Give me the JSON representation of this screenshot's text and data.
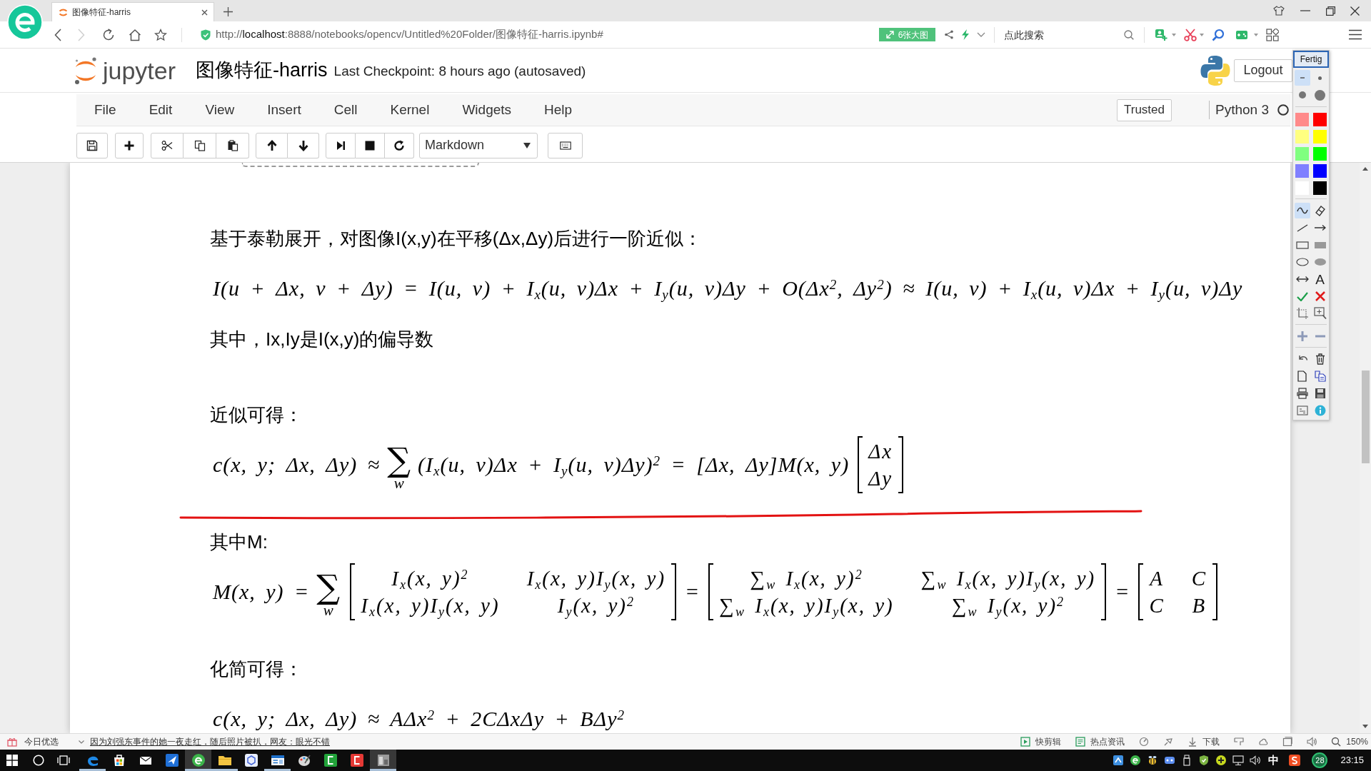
{
  "browser": {
    "tab": {
      "title": "图像特征-harris"
    },
    "forward": {
      "disabled": true
    },
    "address": {
      "url": "http://**localhost**:8888/notebooks/opencv/Untitled%20Folder/图像特征-harris.ipynb#"
    },
    "images_button": "6张大图",
    "search": {
      "placeholder": "点此搜索"
    }
  },
  "notebook": {
    "logo_text": "jupyter",
    "title": "图像特征-harris",
    "checkpoint": "Last Checkpoint: 8 hours ago (autosaved)",
    "logout": "Logout",
    "menu": [
      "File",
      "Edit",
      "View",
      "Insert",
      "Cell",
      "Kernel",
      "Widgets",
      "Help"
    ],
    "trusted": "Trusted",
    "kernel": "Python 3",
    "cell_type": "Markdown",
    "cells": [
      {
        "blocks": [
          {
            "kind": "text",
            "text": "基于泰勒展开，对图像I(x,y)在平移(Δx,Δy)后进行一阶近似："
          },
          {
            "kind": "formula",
            "parts": [
              {
                "kind": "expr",
                "text": "I(u + Δx, v + Δy) = I(u, v) + I$_{x}$(u, v)Δx + I$_{y}$(u, v)Δy + O(Δx$^{2}$, Δy$^{2}$) ≈ I(u, v) + I$_{x}$(u, v)Δx + I$_{y}$(u, v)Δy"
              }
            ]
          },
          {
            "kind": "text",
            "text": "其中，Ix,Iy是I(x,y)的偏导数"
          }
        ]
      },
      {
        "blocks": [
          {
            "kind": "text",
            "text": "近似可得："
          },
          {
            "kind": "formula",
            "parts": [
              {
                "kind": "expr",
                "text": "c(x, y; Δx, Δy) ≈"
              },
              {
                "kind": "sum",
                "symbol": "∑",
                "index": "w"
              },
              {
                "kind": "expr",
                "text": "(I$_{x}$(u, v)Δx + I$_{y}$(u, v)Δy)$^{2}$ = [Δx, Δy]M(x, y)"
              },
              {
                "kind": "matrix",
                "rows": [
                  [
                    "Δx"
                  ],
                  [
                    "Δy"
                  ]
                ]
              }
            ]
          }
        ]
      },
      {
        "blocks": [
          {
            "kind": "text",
            "text": "其中M:"
          },
          {
            "kind": "formula",
            "parts": [
              {
                "kind": "expr",
                "text": "M(x, y) ="
              },
              {
                "kind": "sum",
                "symbol": "∑",
                "index": "w"
              },
              {
                "kind": "matrix",
                "rows": [
                  [
                    "I$_{x}$(x, y)$^{2}$",
                    "I$_{x}$(x, y)I$_{y}$(x, y)"
                  ],
                  [
                    "I$_{x}$(x, y)I$_{y}$(x, y)",
                    "I$_{y}$(x, y)$^{2}$"
                  ]
                ]
              },
              {
                "kind": "expr",
                "text": "="
              },
              {
                "kind": "matrix",
                "rows": [
                  [
                    "∑$_{w}$ I$_{x}$(x, y)$^{2}$",
                    "∑$_{w}$ I$_{x}$(x, y)I$_{y}$(x, y)"
                  ],
                  [
                    "∑$_{w}$ I$_{x}$(x, y)I$_{y}$(x, y)",
                    "∑$_{w}$ I$_{y}$(x, y)$^{2}$"
                  ]
                ]
              },
              {
                "kind": "expr",
                "text": "="
              },
              {
                "kind": "matrix",
                "rows": [
                  [
                    "A",
                    "C"
                  ],
                  [
                    "C",
                    "B"
                  ]
                ]
              }
            ]
          }
        ]
      },
      {
        "blocks": [
          {
            "kind": "text",
            "text": "化简可得："
          },
          {
            "kind": "formula",
            "parts": [
              {
                "kind": "expr",
                "text": "c(x, y; Δx, Δy) ≈ AΔx$^{2}$ + 2CΔxΔy + BΔy$^{2}$"
              }
            ]
          }
        ]
      }
    ]
  },
  "annotation_palette": {
    "done_button": "Fertig",
    "sizes": [
      {
        "kind": "thin",
        "selected": true
      },
      {
        "kind": "small",
        "selected": false
      },
      {
        "kind": "medium",
        "selected": false
      },
      {
        "kind": "large",
        "selected": false
      }
    ],
    "colors": [
      {
        "color": "#ff8a8a"
      },
      {
        "color": "#ff0000"
      },
      {
        "color": "#ffff80"
      },
      {
        "color": "#ffff00"
      },
      {
        "color": "#80ff80"
      },
      {
        "color": "#00ff00"
      },
      {
        "color": "#8080ff"
      },
      {
        "color": "#0000ff"
      },
      {
        "color": "#ffffff"
      },
      {
        "color": "#000000"
      }
    ],
    "tools": [
      {
        "kind": "pen",
        "selected": true
      },
      {
        "kind": "eraser",
        "selected": false
      },
      {
        "kind": "line",
        "selected": false
      },
      {
        "kind": "arrow",
        "selected": false
      },
      {
        "kind": "rectangle",
        "selected": false
      },
      {
        "kind": "filled_rectangle",
        "selected": false
      },
      {
        "kind": "ellipse",
        "selected": false
      },
      {
        "kind": "filled_ellipse",
        "selected": false
      },
      {
        "kind": "double_arrow",
        "selected": false
      },
      {
        "kind": "text",
        "selected": false,
        "glyph": "A"
      },
      {
        "kind": "check",
        "selected": false
      },
      {
        "kind": "cross",
        "selected": false
      },
      {
        "kind": "crop",
        "selected": false
      },
      {
        "kind": "zoom",
        "selected": false
      }
    ]
  },
  "status_bar": {
    "left_label": "今日优选",
    "headline": "因为刘强东事件的她一夜走红，随后照片被扒，网友：眼光不错",
    "items": [
      {
        "kind": "clip",
        "label": "快剪辑"
      },
      {
        "kind": "news",
        "label": "热点资讯"
      },
      {
        "kind": "gauge"
      },
      {
        "kind": "pin"
      },
      {
        "kind": "download",
        "label": "下载"
      },
      {
        "kind": "flag"
      },
      {
        "kind": "cloud"
      },
      {
        "kind": "window"
      },
      {
        "kind": "sound"
      },
      {
        "kind": "zoom",
        "label": "150%"
      }
    ]
  },
  "taskbar": {
    "apps": [
      {
        "kind": "edge",
        "open": true,
        "selected": false
      },
      {
        "kind": "store",
        "open": false,
        "selected": false
      },
      {
        "kind": "mail",
        "open": false,
        "selected": false
      },
      {
        "kind": "plane",
        "open": false,
        "selected": false
      },
      {
        "kind": "green_browser",
        "open": true,
        "selected": true
      },
      {
        "kind": "folder",
        "open": true,
        "selected": false
      },
      {
        "kind": "hexagon",
        "open": false,
        "selected": false
      },
      {
        "kind": "news",
        "open": true,
        "selected": false
      },
      {
        "kind": "paint",
        "open": false,
        "selected": false
      },
      {
        "kind": "green_tile",
        "open": false,
        "selected": false
      },
      {
        "kind": "red_tile",
        "open": false,
        "selected": false
      },
      {
        "kind": "thumbnail",
        "open": true,
        "selected": true
      }
    ],
    "ime": "中",
    "badge": "28",
    "clock": "23:15"
  }
}
